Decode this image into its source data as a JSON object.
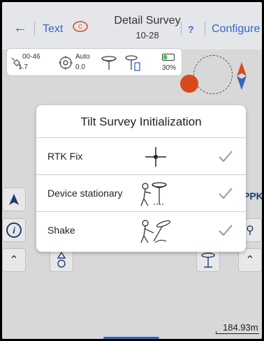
{
  "header": {
    "back_icon": "arrow-left-icon",
    "text_label": "Text",
    "code_icon": "code-tag-icon",
    "title": "Detail Survey",
    "subtitle": "10-28",
    "help_label": "?",
    "configure_label": "Configure"
  },
  "status": {
    "satellite_icon": "satellite-icon",
    "satellites": "00-46",
    "pdop": "1.7",
    "solution_icon": "crosshair-circle-icon",
    "solution_mode": "Auto",
    "solution_value": "0.0",
    "receiver_icon": "gnss-receiver-icon",
    "controller_icon": "controller-icon",
    "battery_icon": "battery-icon",
    "battery_percent": "30%",
    "battery_level": 0.3,
    "battery_color": "#2fcf3f"
  },
  "map": {
    "ppk_label": "PPK",
    "scale_label": "184.93m"
  },
  "dialog": {
    "title": "Tilt Survey Initialization",
    "rows": [
      {
        "label": "RTK Fix",
        "icon": "crosshair-icon",
        "check_icon": "checkmark-icon"
      },
      {
        "label": "Device stationary",
        "icon": "surveyor-stationary-icon",
        "check_icon": "checkmark-icon"
      },
      {
        "label": "Shake",
        "icon": "surveyor-shake-icon",
        "check_icon": "checkmark-icon"
      }
    ]
  },
  "colors": {
    "accent": "#3565c4",
    "check": "#9a9a9a",
    "compass_dot": "#d84a1c"
  }
}
